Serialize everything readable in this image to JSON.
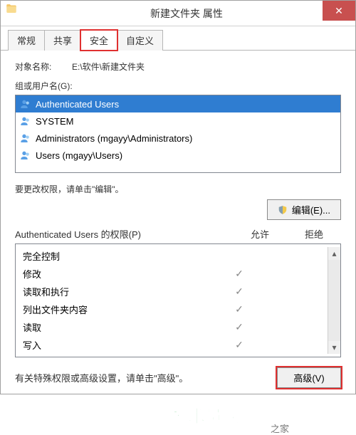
{
  "window": {
    "title": "新建文件夹 属性"
  },
  "tabs": {
    "items": [
      "常规",
      "共享",
      "安全",
      "自定义"
    ],
    "activeIndex": 2
  },
  "object": {
    "label": "对象名称:",
    "value": "E:\\软件\\新建文件夹"
  },
  "groups": {
    "label": "组或用户名(G):",
    "items": [
      {
        "name": "Authenticated Users",
        "selected": true
      },
      {
        "name": "SYSTEM",
        "selected": false
      },
      {
        "name": "Administrators (mgayy\\Administrators)",
        "selected": false
      },
      {
        "name": "Users (mgayy\\Users)",
        "selected": false
      }
    ]
  },
  "editHint": "要更改权限，请单击\"编辑\"。",
  "editButton": "编辑(E)...",
  "permissions": {
    "header": "Authenticated Users 的权限(P)",
    "allow": "允许",
    "deny": "拒绝",
    "rows": [
      {
        "name": "完全控制",
        "allow": false,
        "deny": false
      },
      {
        "name": "修改",
        "allow": true,
        "deny": false
      },
      {
        "name": "读取和执行",
        "allow": true,
        "deny": false
      },
      {
        "name": "列出文件夹内容",
        "allow": true,
        "deny": false
      },
      {
        "name": "读取",
        "allow": true,
        "deny": false
      },
      {
        "name": "写入",
        "allow": true,
        "deny": false
      }
    ]
  },
  "advanced": {
    "text": "有关特殊权限或高级设置，请单击\"高级\"。",
    "button": "高级(V)"
  },
  "watermark": "技术员联盟",
  "watermark2": "之家"
}
